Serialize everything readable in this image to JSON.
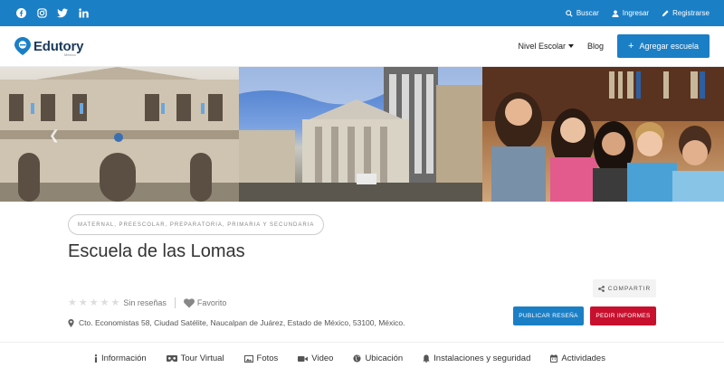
{
  "topbar": {
    "social": [
      "facebook-icon",
      "instagram-icon",
      "twitter-icon",
      "linkedin-icon"
    ],
    "links": {
      "search": "Buscar",
      "login": "Ingresar",
      "register": "Registrarse"
    },
    "color": "#1b7fc6"
  },
  "header": {
    "logo_text": "Edutory",
    "logo_sub": "México",
    "nav": {
      "level": "Nivel Escolar",
      "blog": "Blog",
      "add_school": "Agregar escuela"
    }
  },
  "school": {
    "levels": "Maternal, Preescolar, Preparatoria, Primaria y Secundaria",
    "name": "Escuela de las Lomas",
    "reviews_text": "Sin reseñas",
    "stars_filled": 0,
    "stars_total": 5,
    "favorite": "Favorito",
    "address": "Cto. Economistas 58, Ciudad Satélite, Naucalpan de Juárez, Estado de México, 53100, México."
  },
  "actions": {
    "share": "COMPARTIR",
    "publish_review": "PUBLICAR RESEÑA",
    "request_info": "PEDIR INFORMES",
    "review_color": "#1b7fc6",
    "info_color": "#c8102e"
  },
  "tabs": [
    {
      "label": "Información",
      "icon": "info-icon"
    },
    {
      "label": "Tour Virtual",
      "icon": "vr-icon"
    },
    {
      "label": "Fotos",
      "icon": "image-icon"
    },
    {
      "label": "Video",
      "icon": "video-icon"
    },
    {
      "label": "Ubicación",
      "icon": "globe-icon"
    },
    {
      "label": "Instalaciones y seguridad",
      "icon": "bell-icon"
    },
    {
      "label": "Actividades",
      "icon": "calendar-icon"
    }
  ]
}
